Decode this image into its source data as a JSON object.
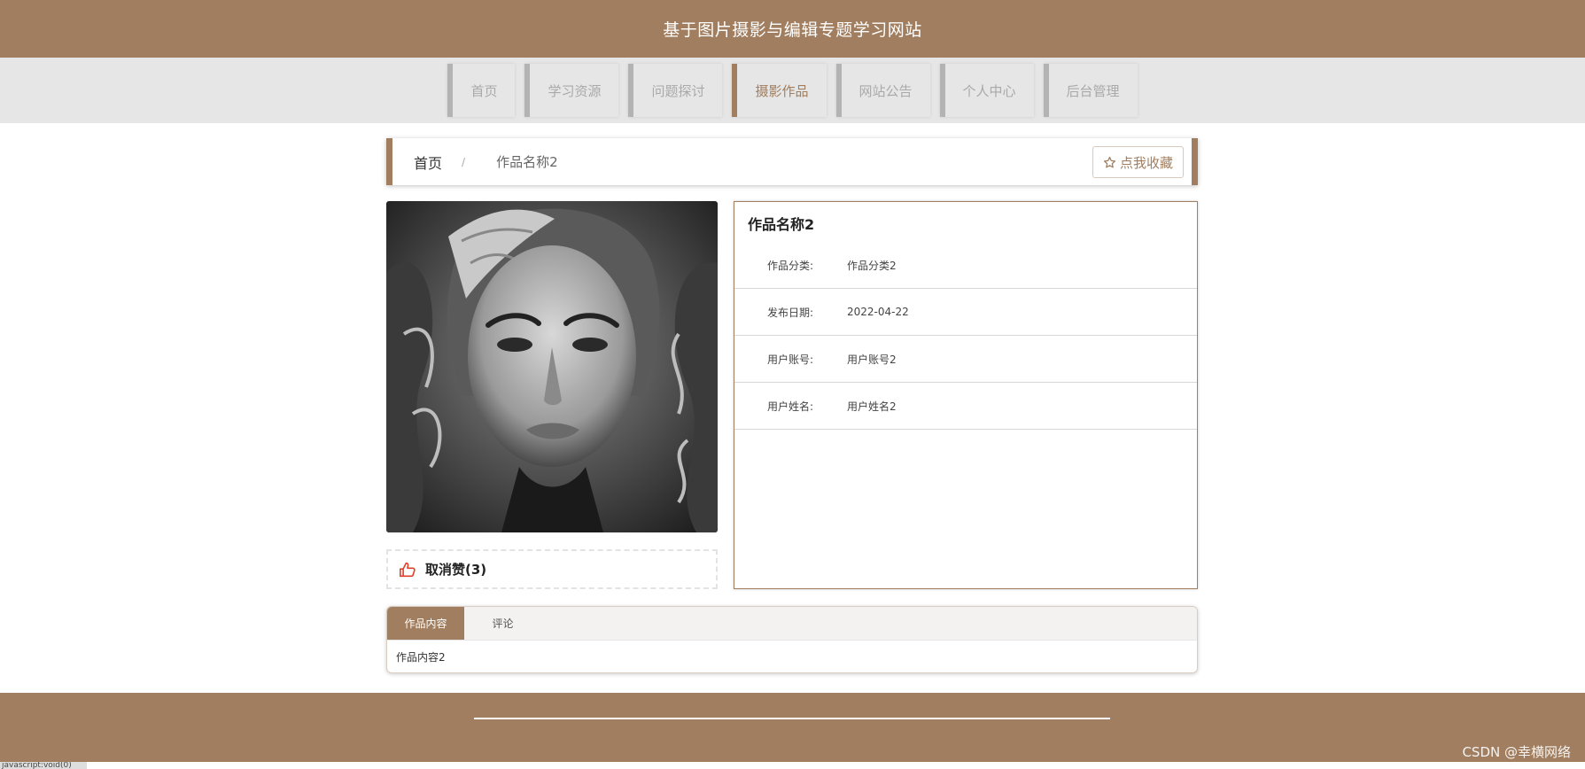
{
  "header": {
    "title": "基于图片摄影与编辑专题学习网站"
  },
  "nav": {
    "items": [
      {
        "label": "首页"
      },
      {
        "label": "学习资源"
      },
      {
        "label": "问题探讨"
      },
      {
        "label": "摄影作品"
      },
      {
        "label": "网站公告"
      },
      {
        "label": "个人中心"
      },
      {
        "label": "后台管理"
      }
    ],
    "active_index": 3
  },
  "breadcrumb": {
    "home": "首页",
    "separator": "/",
    "current": "作品名称2"
  },
  "favorite_button": {
    "label": "点我收藏"
  },
  "like": {
    "label": "取消赞(3)"
  },
  "details": {
    "title": "作品名称2",
    "rows": [
      {
        "key": "作品分类:",
        "value": "作品分类2"
      },
      {
        "key": "发布日期:",
        "value": "2022-04-22"
      },
      {
        "key": "用户账号:",
        "value": "用户账号2"
      },
      {
        "key": "用户姓名:",
        "value": "用户姓名2"
      }
    ]
  },
  "tabs": {
    "items": [
      {
        "label": "作品内容"
      },
      {
        "label": "评论"
      }
    ],
    "active_index": 0,
    "content": "作品内容2"
  },
  "footer": {
    "watermark": "CSDN @幸横网络"
  },
  "statusbar": {
    "text": "javascript:void(0)"
  },
  "colors": {
    "brand": "#a07e5f",
    "nav_bg": "#e6e6e6",
    "like_icon": "#e0412b"
  },
  "icons": {
    "favorite": "star-icon",
    "like": "thumbs-up-icon"
  }
}
